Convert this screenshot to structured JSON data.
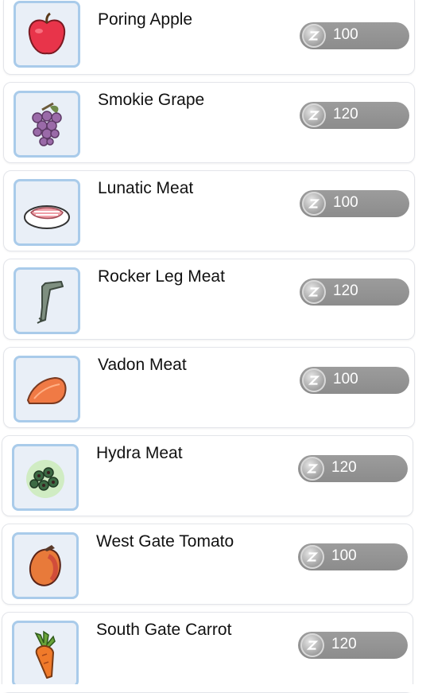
{
  "shop": {
    "items": [
      {
        "name": "Poring Apple",
        "price": "100",
        "icon": "apple-icon"
      },
      {
        "name": "Smokie Grape",
        "price": "120",
        "icon": "grape-icon"
      },
      {
        "name": "Lunatic Meat",
        "price": "100",
        "icon": "meat-slice-icon"
      },
      {
        "name": "Rocker Leg Meat",
        "price": "120",
        "icon": "leg-meat-icon"
      },
      {
        "name": "Vadon Meat",
        "price": "100",
        "icon": "vadon-meat-icon"
      },
      {
        "name": "Hydra Meat",
        "price": "120",
        "icon": "hydra-meat-icon"
      },
      {
        "name": "West Gate Tomato",
        "price": "100",
        "icon": "tomato-icon"
      },
      {
        "name": "South Gate Carrot",
        "price": "120",
        "icon": "carrot-icon"
      }
    ],
    "currency_icon": "zeny-coin-icon",
    "colors": {
      "frame_border": "#a9cbea",
      "frame_bg": "#e9eff7",
      "pill": "#959595",
      "price_text": "#ffffff"
    }
  }
}
